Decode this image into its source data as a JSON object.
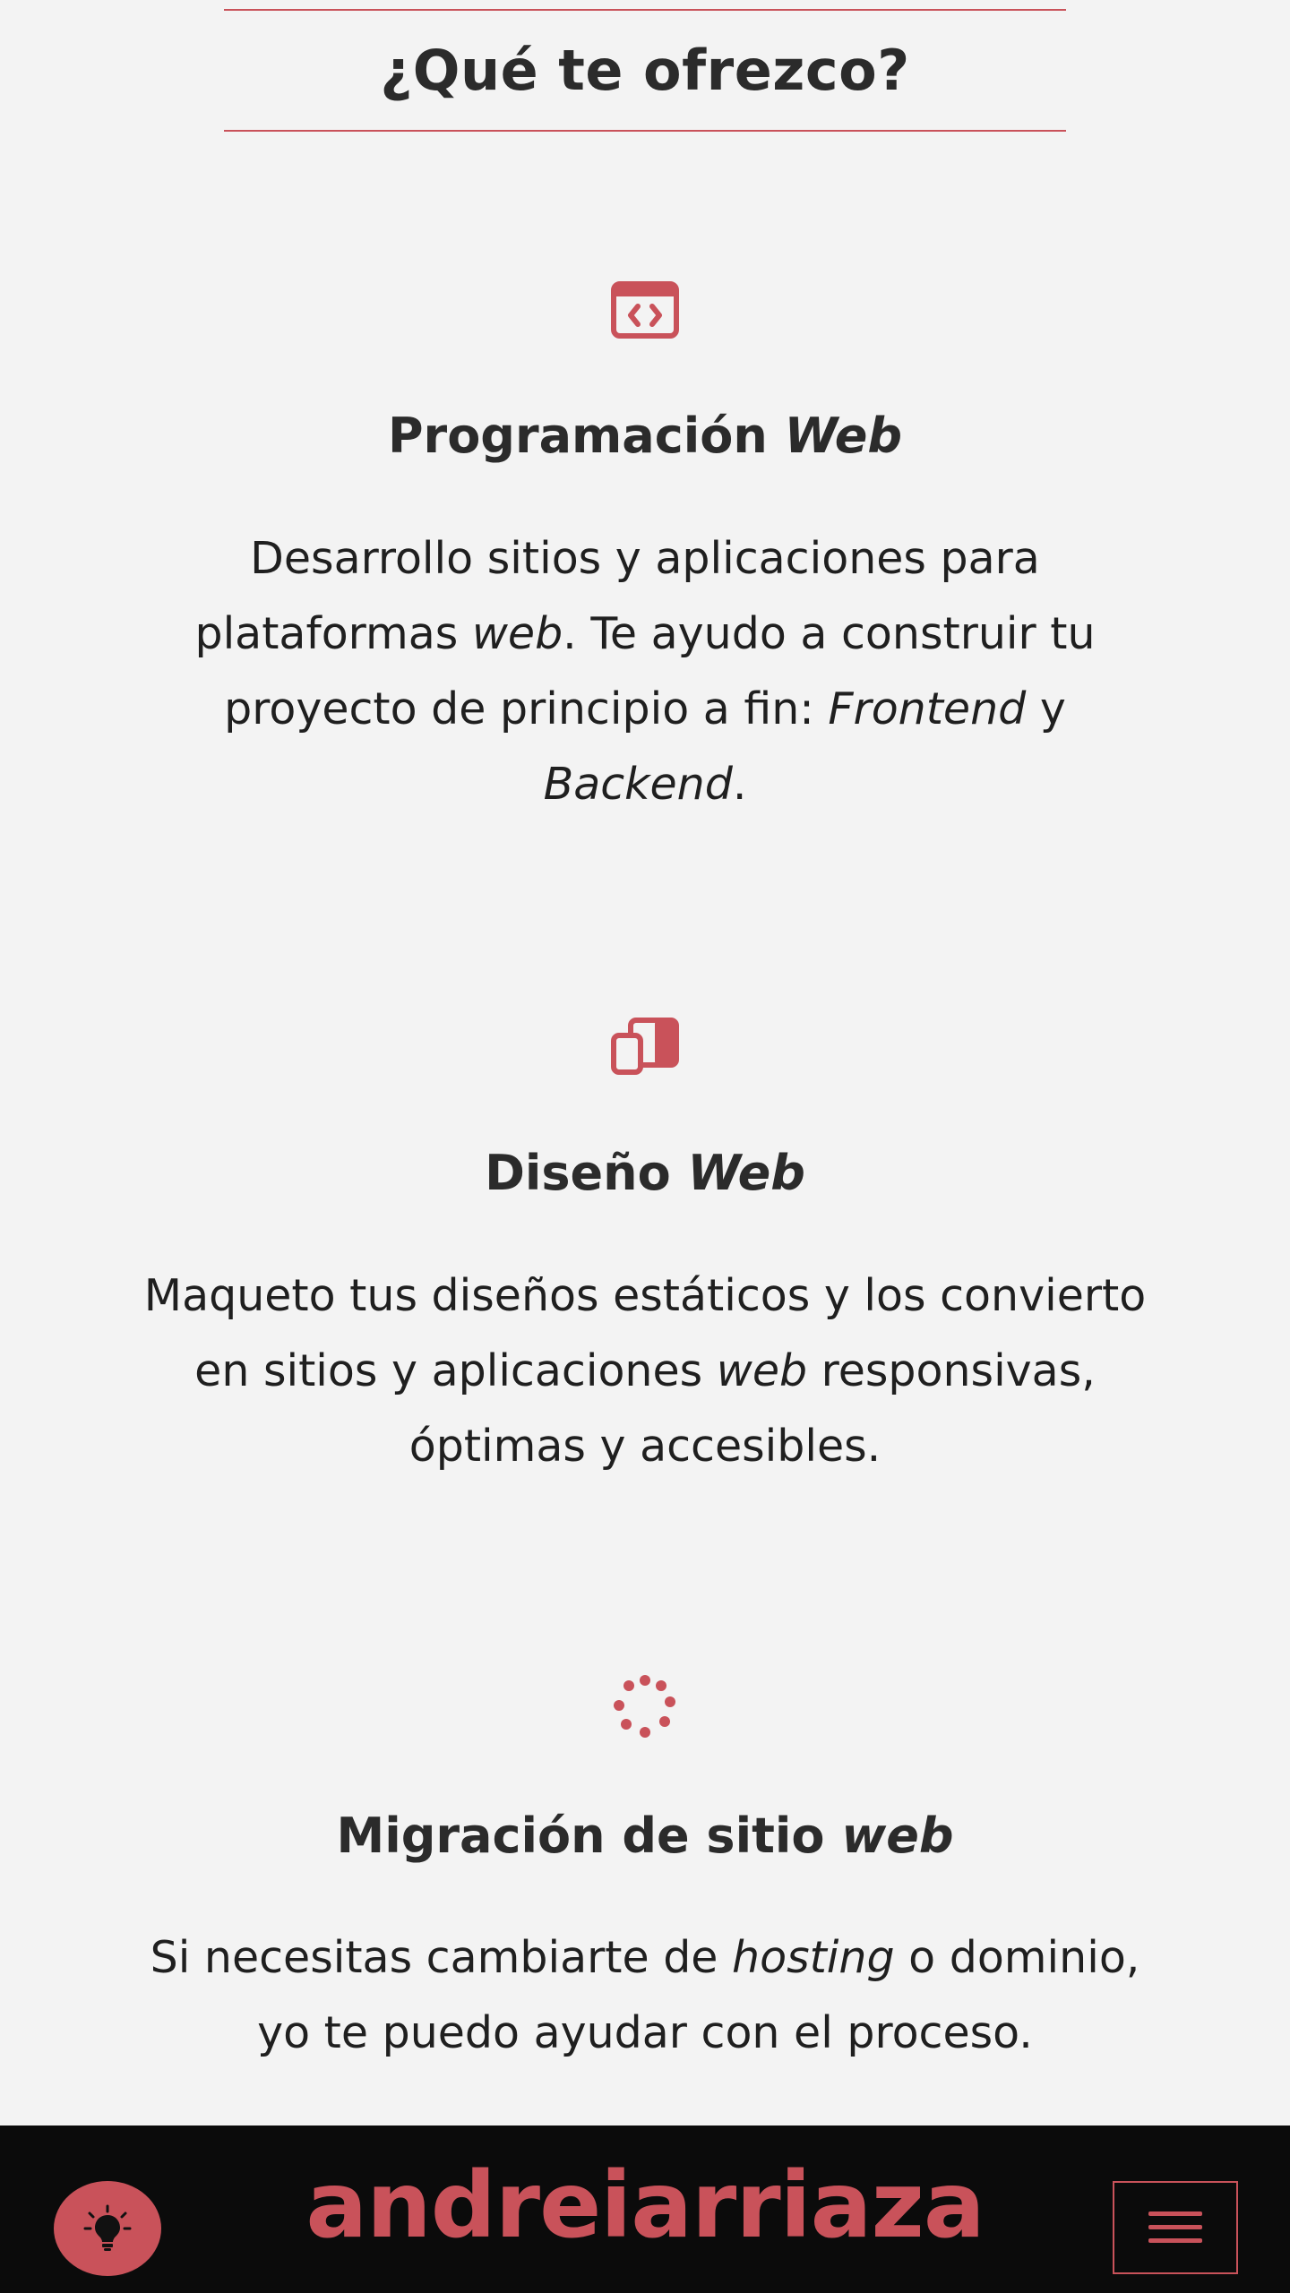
{
  "section": {
    "title": "¿Qué te ofrezco?"
  },
  "services": [
    {
      "icon": "code-window-icon",
      "title": "Programación",
      "title_em": "Web",
      "desc": [
        {
          "t": "Desarrollo sitios y aplicaciones para plataformas "
        },
        {
          "t": "web",
          "em": true
        },
        {
          "t": ". Te ayudo a construir tu proyecto de principio a fin: "
        },
        {
          "t": "Frontend",
          "em": true
        },
        {
          "t": " y "
        },
        {
          "t": "Backend",
          "em": true
        },
        {
          "t": "."
        }
      ]
    },
    {
      "icon": "devices-icon",
      "title": "Diseño",
      "title_em": "Web",
      "desc": [
        {
          "t": "Maqueto tus diseños estáticos y los convierto en sitios y aplicaciones "
        },
        {
          "t": "web",
          "em": true
        },
        {
          "t": " responsivas, óptimas y accesibles."
        }
      ]
    },
    {
      "icon": "spinner-dots-icon",
      "title": "Migración de sitio",
      "title_em": "web",
      "desc": [
        {
          "t": "Si necesitas cambiarte de "
        },
        {
          "t": "hosting",
          "em": true
        },
        {
          "t": " o dominio, yo te puedo ayudar con el proceso."
        }
      ]
    }
  ],
  "navbar": {
    "brand": "andreiarriaza",
    "theme_toggle_icon": "lightbulb-icon",
    "menu_icon": "hamburger-menu-icon"
  },
  "colors": {
    "accent": "#c9525a",
    "background": "#f3f3f3",
    "text": "#2b2b2b",
    "navbar": "#0b0b0b"
  }
}
